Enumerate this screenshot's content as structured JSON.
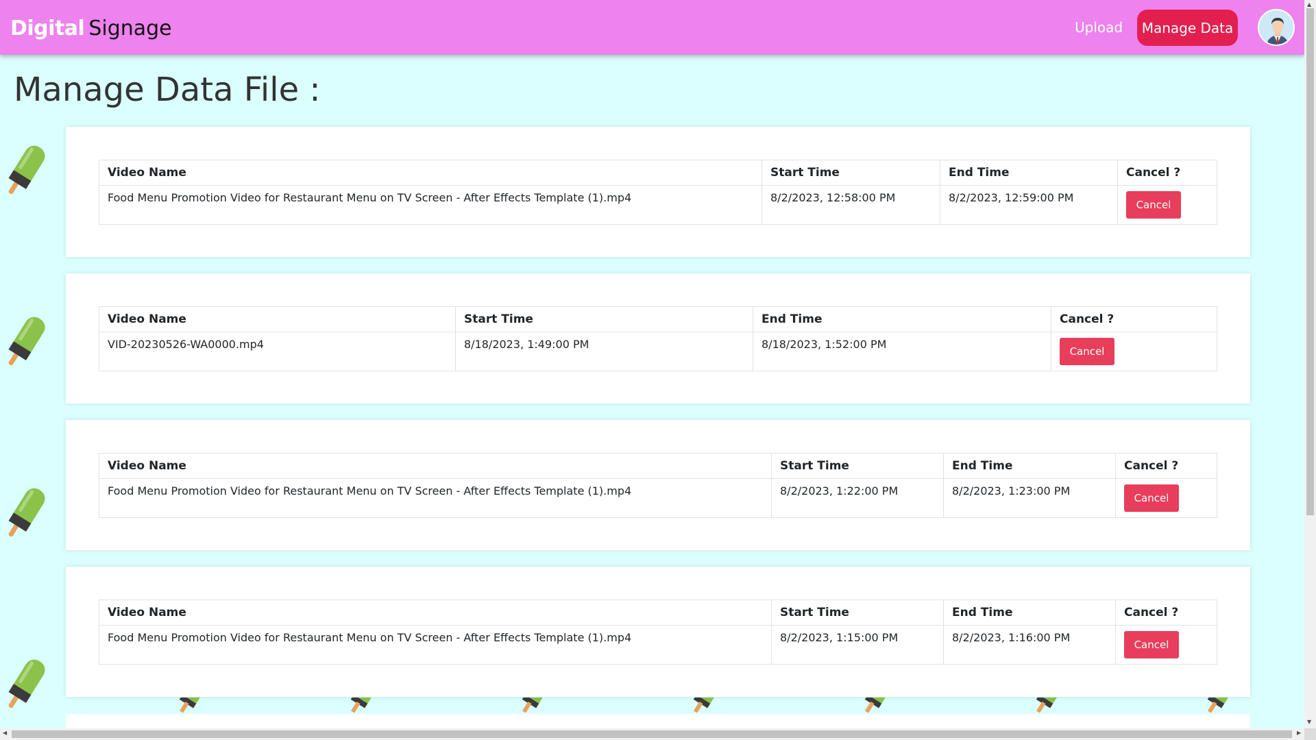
{
  "brand": {
    "part1": "Digital",
    "part2": "Signage"
  },
  "nav": {
    "upload": "Upload",
    "manage": "Manage Data"
  },
  "page": {
    "title": "Manage Data File :"
  },
  "table_headers": {
    "name": "Video Name",
    "start": "Start Time",
    "end": "End Time",
    "cancel": "Cancel ?"
  },
  "cancel_label": "Cancel",
  "rows": [
    {
      "name": "Food Menu Promotion Video for Restaurant Menu on TV Screen - After Effects Template (1).mp4",
      "start": "8/2/2023, 12:58:00 PM",
      "end": "8/2/2023, 12:59:00 PM"
    },
    {
      "name": "VID-20230526-WA0000.mp4",
      "start": "8/18/2023, 1:49:00 PM",
      "end": "8/18/2023, 1:52:00 PM"
    },
    {
      "name": "Food Menu Promotion Video for Restaurant Menu on TV Screen - After Effects Template (1).mp4",
      "start": "8/2/2023, 1:22:00 PM",
      "end": "8/2/2023, 1:23:00 PM"
    },
    {
      "name": "Food Menu Promotion Video for Restaurant Menu on TV Screen - After Effects Template (1).mp4",
      "start": "8/2/2023, 1:15:00 PM",
      "end": "8/2/2023, 1:16:00 PM"
    }
  ],
  "colors": {
    "navbar": "#ee82ee",
    "background": "#dbfffe",
    "accent": "#e31f4f",
    "cancel": "#e83e5b"
  }
}
